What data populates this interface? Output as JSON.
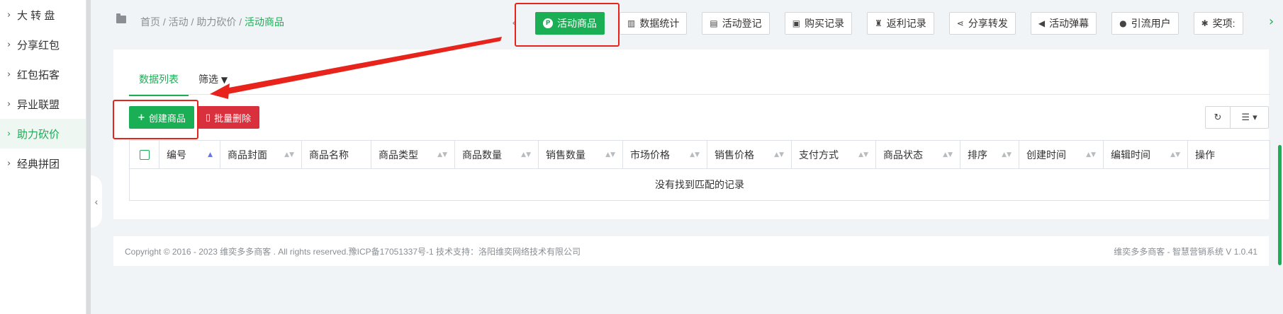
{
  "sidebar": {
    "items": [
      {
        "label": "大 转 盘"
      },
      {
        "label": "分享红包"
      },
      {
        "label": "红包拓客"
      },
      {
        "label": "异业联盟"
      },
      {
        "label": "助力砍价"
      },
      {
        "label": "经典拼团"
      }
    ],
    "active_index": 4
  },
  "breadcrumb": {
    "path": "首页 / 活动 / 助力砍价 / ",
    "current": "活动商品"
  },
  "top_tabs": [
    {
      "label": "活动商品",
      "icon": "p-circle-icon",
      "active": true
    },
    {
      "label": "数据统计",
      "icon": "bar-chart-icon"
    },
    {
      "label": "活动登记",
      "icon": "document-icon"
    },
    {
      "label": "购买记录",
      "icon": "cart-icon"
    },
    {
      "label": "返利记录",
      "icon": "trophy-icon"
    },
    {
      "label": "分享转发",
      "icon": "share-icon"
    },
    {
      "label": "活动弹幕",
      "icon": "megaphone-icon"
    },
    {
      "label": "引流用户",
      "icon": "users-icon"
    },
    {
      "label": "奖项:",
      "icon": "bug-icon"
    }
  ],
  "subtabs": {
    "data_list": "数据列表",
    "filter": "筛选"
  },
  "actions": {
    "create": "创建商品",
    "batch_delete": "批量删除"
  },
  "table": {
    "columns": [
      "编号",
      "商品封面",
      "商品名称",
      "商品类型",
      "商品数量",
      "销售数量",
      "市场价格",
      "销售价格",
      "支付方式",
      "商品状态",
      "排序",
      "创建时间",
      "编辑时间",
      "操作"
    ],
    "empty_text": "没有找到匹配的记录"
  },
  "footer": {
    "left": "Copyright © 2016 - 2023 维奕多多商客 . All rights reserved.豫ICP备17051337号-1 技术支持：洛阳维奕网络技术有限公司",
    "right": "维奕多多商客 - 智慧营销系统 V 1.0.41"
  },
  "colors": {
    "accent": "#1aae55",
    "danger": "#d9303d",
    "annotation": "#e8231b"
  }
}
